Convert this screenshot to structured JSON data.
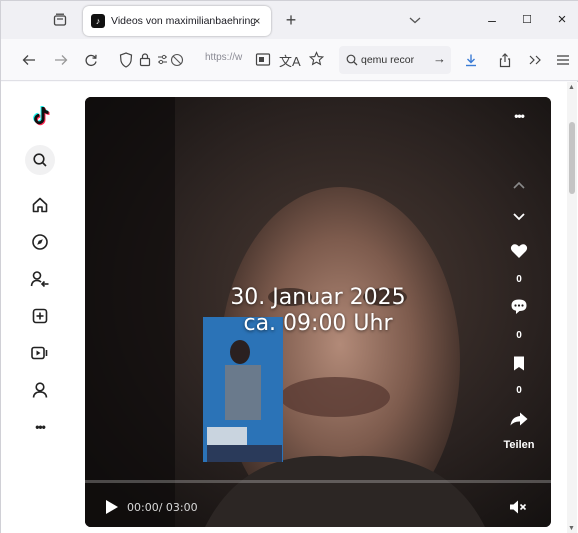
{
  "browser": {
    "tab_title": "Videos von maximilianbaehring",
    "tab_close": "×",
    "newtab": "+",
    "url_text": "https://w",
    "search_text": "qemu recor",
    "search_arrow": "→"
  },
  "window_buttons": {
    "minimize": "–",
    "maximize": "☐",
    "close": "×"
  },
  "video": {
    "overlay_line1": "30. Januar 2025",
    "overlay_line2": "ca. 09:00 Uhr",
    "more_label": "•••",
    "like_count": "0",
    "comment_count": "0",
    "bookmark_count": "0",
    "share_label": "Teilen",
    "time": "00:00/ 03:00",
    "progress": 0
  },
  "sidebar": {
    "items": [
      "tiktok-logo",
      "search",
      "home",
      "explore",
      "following",
      "upload",
      "live",
      "profile",
      "more"
    ],
    "more_label": "•••"
  }
}
